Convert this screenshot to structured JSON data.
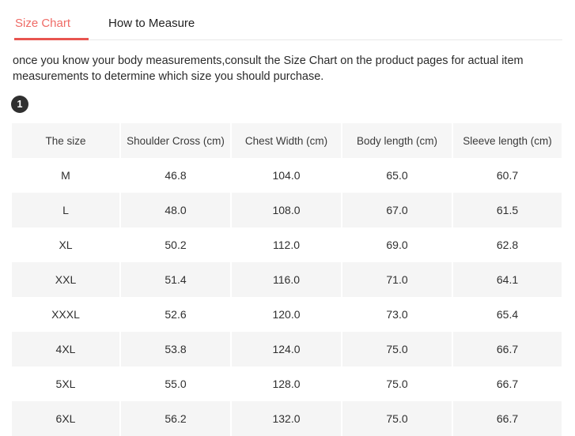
{
  "tabs": [
    {
      "label": "Size Chart",
      "active": true
    },
    {
      "label": "How to Measure",
      "active": false
    }
  ],
  "description": "once you know your body measurements,consult the Size Chart on the product pages for actual item measurements to determine which size you should purchase.",
  "step_badge": {
    "number": "1"
  },
  "colors": {
    "accent": "#e8544f",
    "active_tab_text": "#ef6b66",
    "badge_bg": "#303030",
    "header_bg": "#f6f6f6",
    "stripe_bg": "#f5f5f5"
  },
  "table": {
    "headers": [
      "The size",
      "Shoulder Cross (cm)",
      "Chest Width (cm)",
      "Body length (cm)",
      "Sleeve length (cm)"
    ],
    "rows": [
      [
        "M",
        "46.8",
        "104.0",
        "65.0",
        "60.7"
      ],
      [
        "L",
        "48.0",
        "108.0",
        "67.0",
        "61.5"
      ],
      [
        "XL",
        "50.2",
        "112.0",
        "69.0",
        "62.8"
      ],
      [
        "XXL",
        "51.4",
        "116.0",
        "71.0",
        "64.1"
      ],
      [
        "XXXL",
        "52.6",
        "120.0",
        "73.0",
        "65.4"
      ],
      [
        "4XL",
        "53.8",
        "124.0",
        "75.0",
        "66.7"
      ],
      [
        "5XL",
        "55.0",
        "128.0",
        "75.0",
        "66.7"
      ],
      [
        "6XL",
        "56.2",
        "132.0",
        "75.0",
        "66.7"
      ]
    ]
  }
}
